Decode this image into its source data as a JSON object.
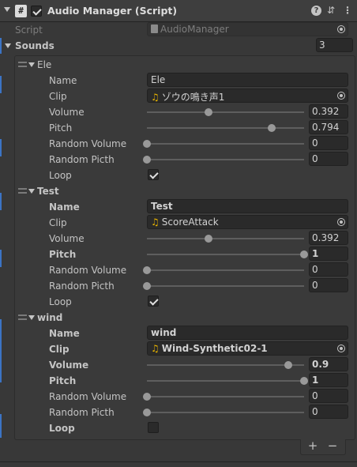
{
  "component": {
    "title": "Audio Manager (Script)",
    "enabled": true,
    "script_icon_glyph": "#",
    "help_glyph": "?",
    "preset_glyph": "⇵",
    "menu_glyph": "⋮"
  },
  "script_field": {
    "label": "Script",
    "value": "AudioManager"
  },
  "sounds": {
    "label": "Sounds",
    "count": "3"
  },
  "labels": {
    "name": "Name",
    "clip": "Clip",
    "volume": "Volume",
    "pitch": "Pitch",
    "random_volume": "Random Volume",
    "random_pitch": "Random Picth",
    "loop": "Loop"
  },
  "elements": [
    {
      "header": "Ele",
      "name": "Ele",
      "clip": "ゾウの鳴き声1",
      "volume": {
        "value": 0.392,
        "text": "0.392"
      },
      "pitch": {
        "value": 0.794,
        "text": "0.794"
      },
      "random_volume": {
        "value": 0,
        "text": "0"
      },
      "random_pitch": {
        "value": 0,
        "text": "0"
      },
      "loop": true
    },
    {
      "header": "Test",
      "name": "Test",
      "clip": "ScoreAttack",
      "volume": {
        "value": 0.392,
        "text": "0.392"
      },
      "pitch": {
        "value": 1,
        "text": "1"
      },
      "random_volume": {
        "value": 0,
        "text": "0"
      },
      "random_pitch": {
        "value": 0,
        "text": "0"
      },
      "loop": true
    },
    {
      "header": "wind",
      "name": "wind",
      "clip": "Wind-Synthetic02-1",
      "volume": {
        "value": 0.9,
        "text": "0.9"
      },
      "pitch": {
        "value": 1,
        "text": "1"
      },
      "random_volume": {
        "value": 0,
        "text": "0"
      },
      "random_pitch": {
        "value": 0,
        "text": "0"
      },
      "loop": false
    }
  ],
  "footer": {
    "add": "+",
    "remove": "−"
  },
  "colors": {
    "background": "#383838",
    "field": "#2a2a2a",
    "accent": "#3c74c4",
    "clip_icon": "#e8b400"
  }
}
